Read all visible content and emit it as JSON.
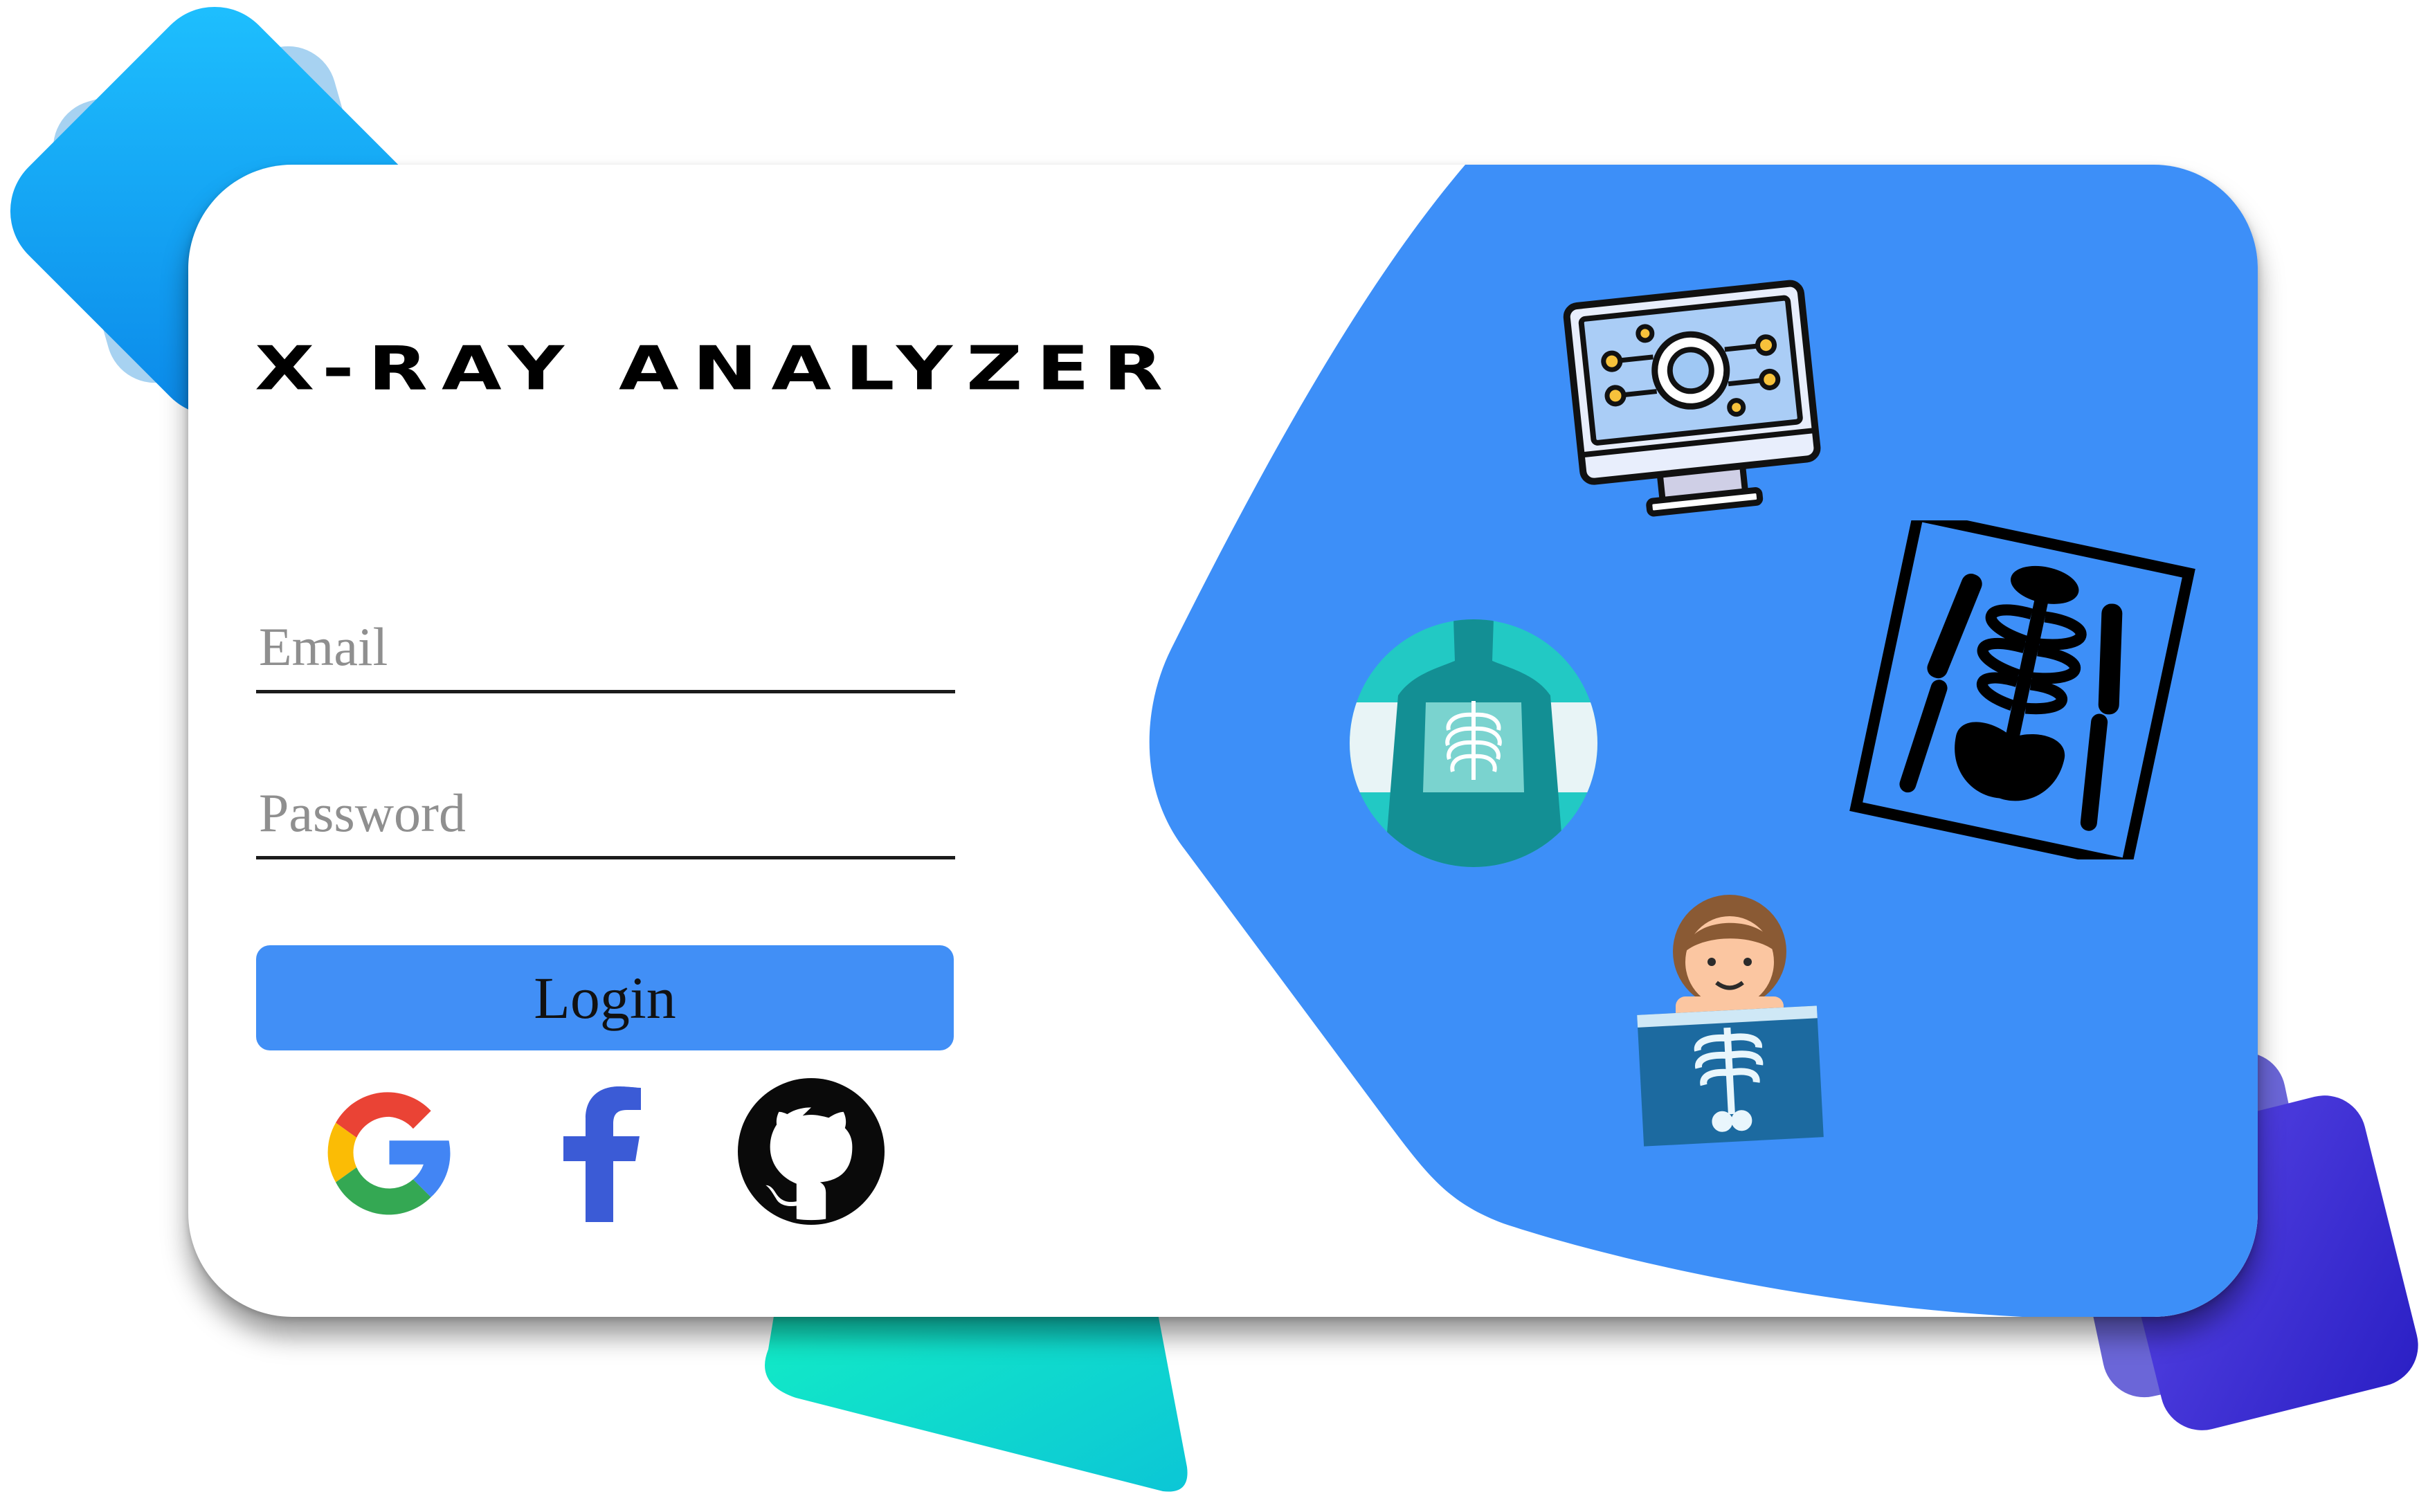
{
  "app": {
    "title": "X-RAY ANALYZER"
  },
  "login_form": {
    "email_placeholder": "Email",
    "password_placeholder": "Password",
    "login_label": "Login"
  },
  "social_logins": [
    {
      "name": "google",
      "icon": "google-icon"
    },
    {
      "name": "facebook",
      "icon": "facebook-icon"
    },
    {
      "name": "github",
      "icon": "github-icon"
    }
  ],
  "illustrations": [
    {
      "icon": "ai-monitor-icon"
    },
    {
      "icon": "skeleton-xray-film-icon"
    },
    {
      "icon": "chest-xray-torso-icon"
    },
    {
      "icon": "patient-xray-icon"
    }
  ],
  "colors": {
    "accent_blue": "#418ff6",
    "panel_blue": "#3d8ff8",
    "card_background": "#ffffff",
    "text": "#000000",
    "placeholder": "#8f8f8f",
    "deco_cyan": "#17b4fb",
    "deco_teal": "#10e6c5",
    "deco_indigo": "#3a32d8"
  }
}
